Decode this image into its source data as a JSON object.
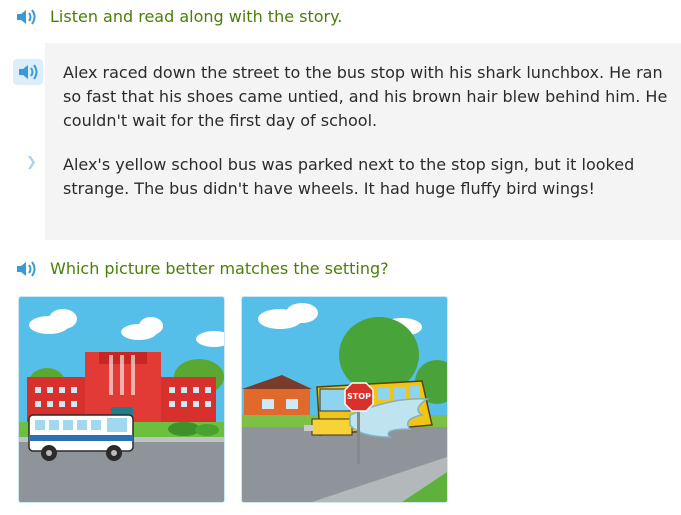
{
  "header": {
    "instruction": "Listen and read along with the story.",
    "speaker_icon": "speaker-icon"
  },
  "story": {
    "paragraphs": [
      "Alex raced down the street to the bus stop with his shark lunchbox. He ran so fast that his shoes came untied, and his brown hair blew behind him. He couldn't wait for the first day of school.",
      "Alex's yellow school bus was parked next to the stop sign, but it looked strange. The bus didn't have wheels. It had huge fluffy bird wings!"
    ]
  },
  "question": {
    "text": "Which picture better matches the setting?"
  },
  "choices": [
    {
      "name": "school-building-picture"
    },
    {
      "name": "winged-bus-picture",
      "sign_text": "STOP"
    }
  ],
  "colors": {
    "accent": "#4a7f07",
    "speaker": "#3a9ad9",
    "box": "#f4f4f4"
  }
}
